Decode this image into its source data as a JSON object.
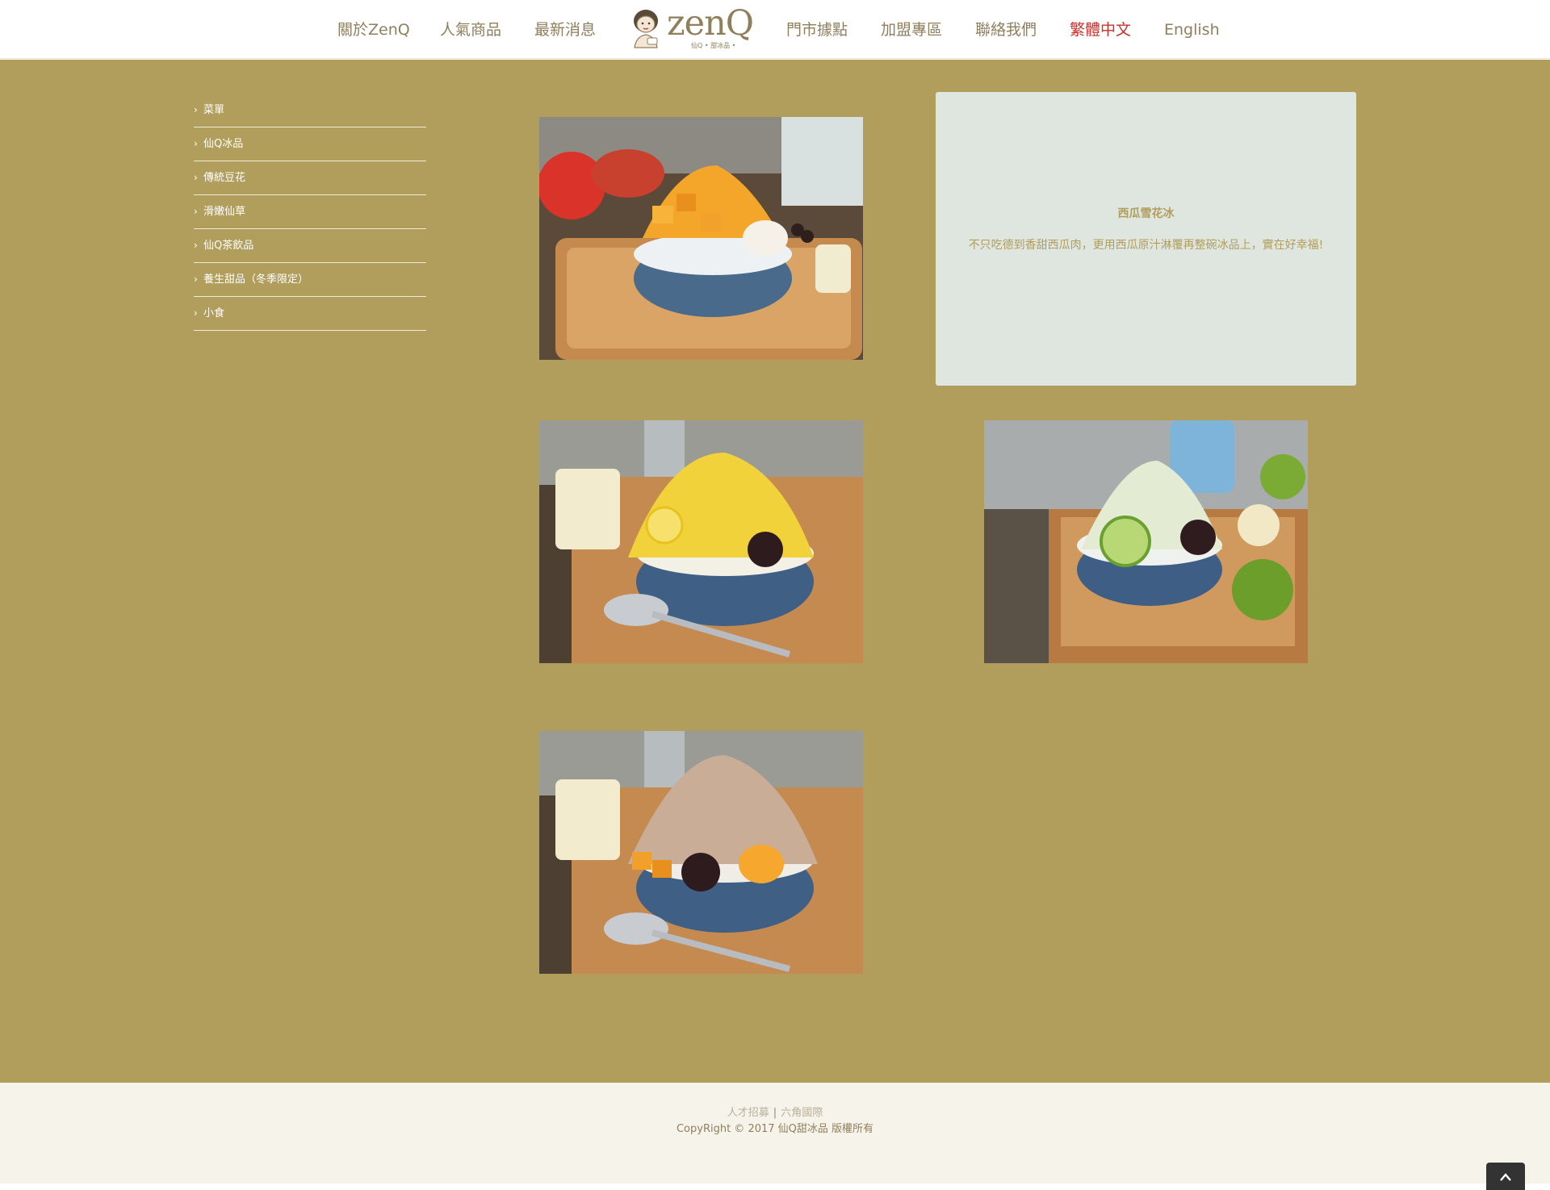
{
  "header": {
    "nav_left": [
      "關於ZenQ",
      "人氣商品",
      "最新消息"
    ],
    "nav_right": [
      "門市據點",
      "加盟專區",
      "聯絡我們",
      "繁體中文",
      "English"
    ],
    "logo": {
      "word": "zenQ",
      "subtitle": "仙Q • 甜冰品 •"
    },
    "active_color": "#c9302c"
  },
  "sidebar": {
    "items": [
      "菜單",
      "仙Q冰品",
      "傳統豆花",
      "滑嫩仙草",
      "仙Q茶飲品",
      "養生甜品（冬季限定）",
      "小食"
    ]
  },
  "info_card": {
    "title": "西瓜雪花冰",
    "description": "不只吃德到香甜西瓜肉，更用西瓜原汁淋覆再整碗冰品上，實在好幸福!"
  },
  "photos": [
    {
      "subject": "mango-shaved-ice"
    },
    {
      "subject": "lemon-shaved-ice"
    },
    {
      "subject": "lime-shaved-ice"
    },
    {
      "subject": "brown-sugar-mango-shaved-ice"
    }
  ],
  "footer": {
    "links": [
      "人才招募",
      "六角國際"
    ],
    "copyright": "CopyRight © 2017 仙Q甜冰品 版權所有"
  },
  "colors": {
    "main_background": "#b19e5d",
    "nav_text": "#8f7f5c",
    "card_background": "#dfe5df",
    "footer_background": "#f6f3ea"
  },
  "icons": [
    "chevron-right-icon",
    "arrow-up-icon",
    "girl-mascot-icon"
  ]
}
